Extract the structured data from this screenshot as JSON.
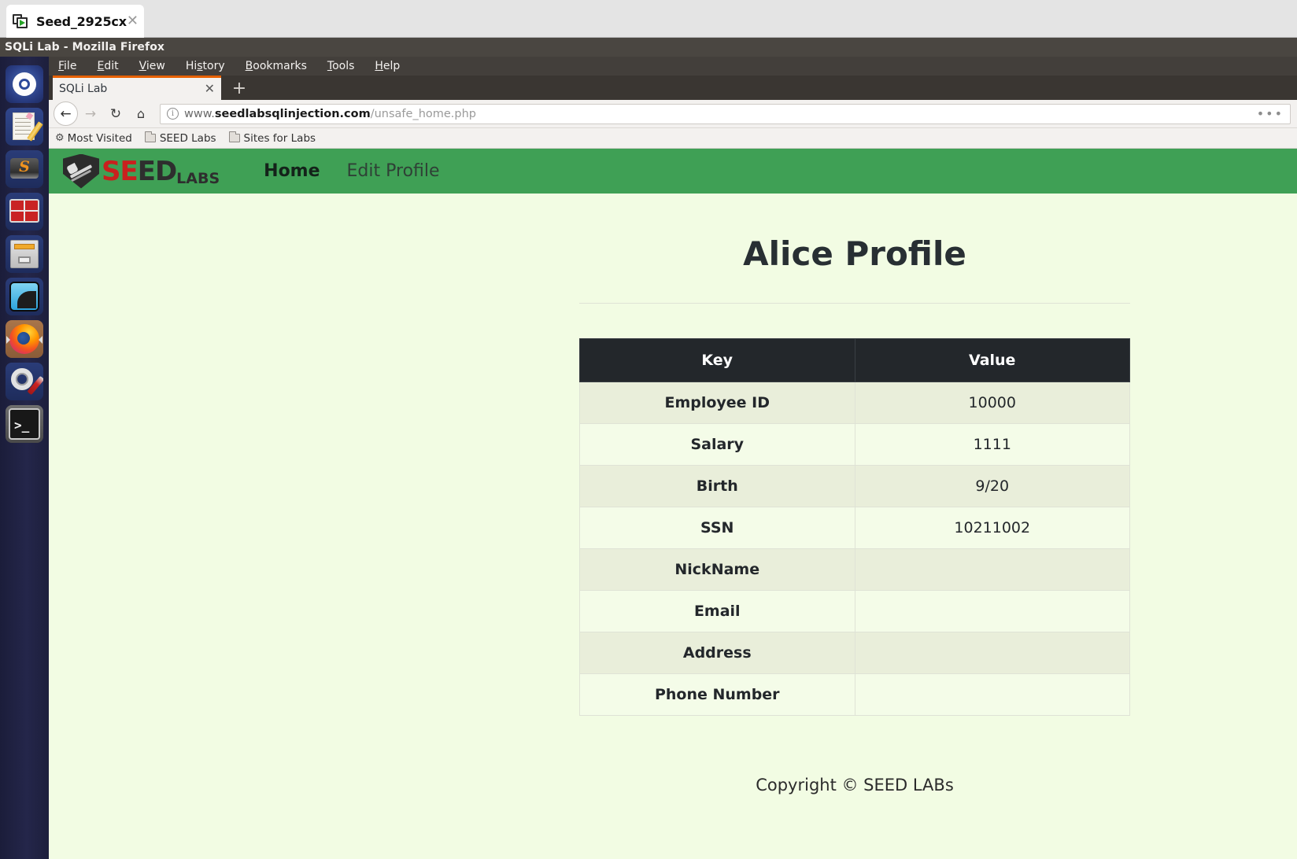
{
  "vm": {
    "tab_title": "Seed_2925cx",
    "tab_icon": "vm-screen-icon",
    "close_icon": "close-icon"
  },
  "window": {
    "title": "SQLi Lab - Mozilla Firefox"
  },
  "launcher": {
    "items": [
      {
        "name": "ubuntu-dash-icon",
        "label": "Ubuntu Dash"
      },
      {
        "name": "text-editor-icon",
        "label": "Text Editor"
      },
      {
        "name": "sublime-text-icon",
        "label": "Sublime Text"
      },
      {
        "name": "guake-terminal-icon",
        "label": "Guake Terminal"
      },
      {
        "name": "files-icon",
        "label": "Files"
      },
      {
        "name": "wireshark-icon",
        "label": "Wireshark"
      },
      {
        "name": "firefox-icon",
        "label": "Firefox"
      },
      {
        "name": "settings-icon",
        "label": "System Settings"
      },
      {
        "name": "terminal-icon",
        "label": "Terminal"
      }
    ]
  },
  "browser": {
    "menu": [
      {
        "label": "File",
        "accel": "F"
      },
      {
        "label": "Edit",
        "accel": "E"
      },
      {
        "label": "View",
        "accel": "V"
      },
      {
        "label": "History",
        "accel": "s"
      },
      {
        "label": "Bookmarks",
        "accel": "B"
      },
      {
        "label": "Tools",
        "accel": "T"
      },
      {
        "label": "Help",
        "accel": "H"
      }
    ],
    "tab": {
      "title": "SQLi Lab",
      "close_icon": "close-icon"
    },
    "new_tab_icon": "plus-icon",
    "toolbar": {
      "back_icon": "arrow-left-icon",
      "forward_icon": "arrow-right-icon",
      "reload_icon": "reload-icon",
      "home_icon": "home-icon",
      "page_actions_icon": "ellipsis-icon"
    },
    "url": {
      "identity_icon": "info-circle-icon",
      "prefix": "www.",
      "domain": "seedlabsqlinjection.com",
      "path": "/unsafe_home.php",
      "full": "www.seedlabsqlinjection.com/unsafe_home.php"
    },
    "bookmarks": [
      {
        "label": "Most Visited",
        "icon": "gear-icon"
      },
      {
        "label": "SEED Labs",
        "icon": "folder-icon"
      },
      {
        "label": "Sites for Labs",
        "icon": "folder-icon"
      }
    ]
  },
  "site": {
    "brand": {
      "shield_icon": "seed-shield-icon",
      "word_part1": "SE",
      "word_part2": "ED",
      "suffix": "LABS"
    },
    "nav": [
      {
        "label": "Home",
        "active": true
      },
      {
        "label": "Edit Profile",
        "active": false
      }
    ],
    "navbar_color": "#3fa055",
    "page_background": "#f2fce3",
    "title": "Alice Profile",
    "table": {
      "headers": [
        "Key",
        "Value"
      ],
      "rows": [
        {
          "key": "Employee ID",
          "value": "10000"
        },
        {
          "key": "Salary",
          "value": "1111"
        },
        {
          "key": "Birth",
          "value": "9/20"
        },
        {
          "key": "SSN",
          "value": "10211002"
        },
        {
          "key": "NickName",
          "value": ""
        },
        {
          "key": "Email",
          "value": ""
        },
        {
          "key": "Address",
          "value": ""
        },
        {
          "key": "Phone Number",
          "value": ""
        }
      ]
    },
    "footer": "Copyright © SEED LABs"
  }
}
